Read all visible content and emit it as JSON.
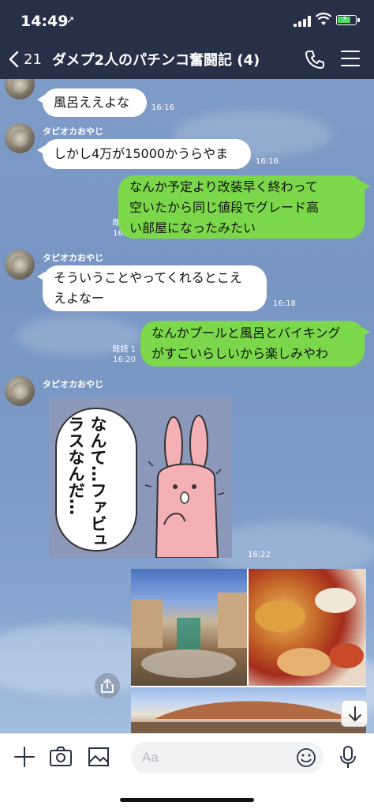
{
  "status_bar": {
    "time": "14:49",
    "location_glyph": "➚"
  },
  "header": {
    "back_count": "21",
    "title": "ダメプ2人のパチンコ奮闘記 (4)"
  },
  "messages": [
    {
      "side": "in",
      "text": "風呂ええよな",
      "time": "16:16"
    },
    {
      "side": "in",
      "sender": "タピオカおやじ",
      "text": "しかし4万が15000かうらやま",
      "time": "16:16"
    },
    {
      "side": "out",
      "lines": [
        "なんか予定より改装早く終わって",
        "空いたから同じ値段でグレード高",
        "い部屋になったみたい"
      ],
      "read": "既読 1",
      "time": "16:17"
    },
    {
      "side": "in",
      "sender": "タピオカおやじ",
      "lines": [
        "そういうことやってくれるとこえ",
        "えよなー"
      ],
      "time": "16:18"
    },
    {
      "side": "out",
      "lines": [
        "なんかプールと風呂とバイキング",
        "がすごいらしいから楽しみやわ"
      ],
      "read": "既読 1",
      "time": "16:20"
    },
    {
      "side": "in",
      "sender": "タピオカおやじ",
      "sticker_text": "なんて…ファビュラスなんだ…",
      "time": "16:22"
    }
  ],
  "input": {
    "placeholder": "Aa"
  }
}
